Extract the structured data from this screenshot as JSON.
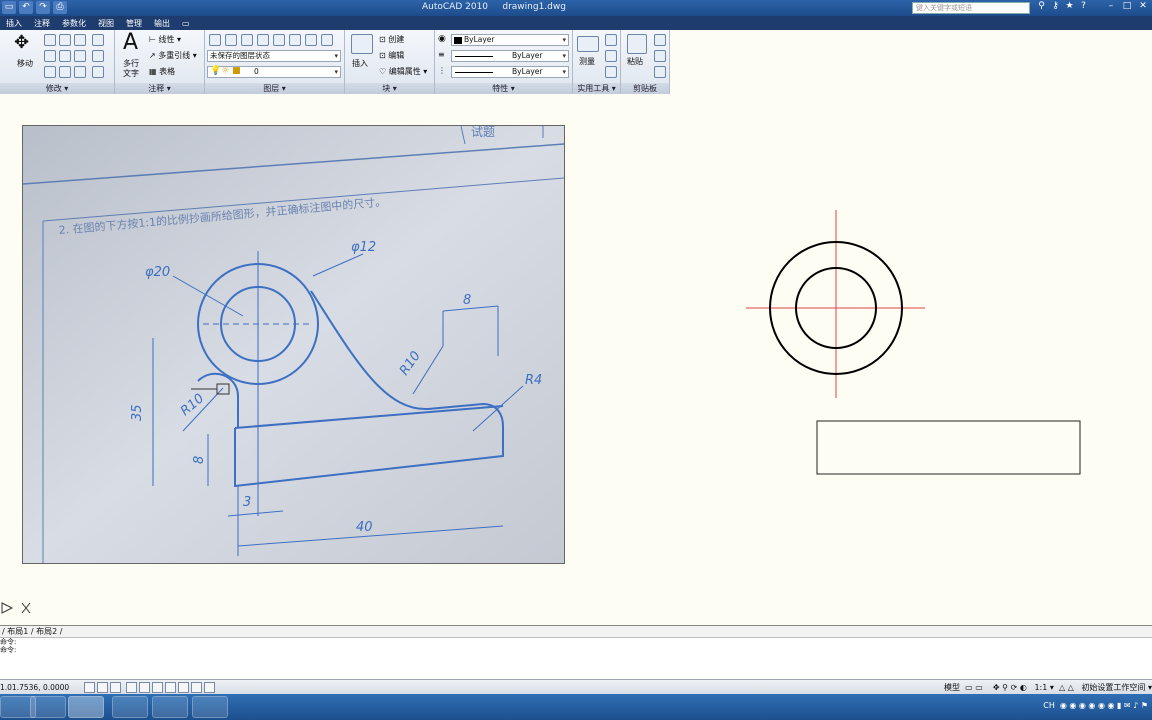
{
  "titlebar": {
    "title": "AutoCAD 2010",
    "file": "drawing1.dwg",
    "search_placeholder": "键入关键字或短语"
  },
  "menu": [
    "插入",
    "注释",
    "参数化",
    "视图",
    "管理",
    "输出"
  ],
  "ribbon": {
    "modify": {
      "label": "修改 ▾",
      "move": "移动"
    },
    "annotation": {
      "label": "注释 ▾",
      "text": "多行\n文字",
      "text_line1": "多行",
      "text_line2": "文字",
      "linear": "线性 ▾",
      "leader": "多重引线 ▾",
      "table": "表格"
    },
    "layers": {
      "label": "图层 ▾",
      "state": "未保存的图层状态",
      "current": "0"
    },
    "block": {
      "label": "块 ▾",
      "insert": "插入",
      "create": "创建",
      "edit": "编辑",
      "edit_attr": "编辑属性 ▾"
    },
    "properties": {
      "label": "特性 ▾",
      "color": "ByLayer",
      "linetype": "ByLayer",
      "lineweight": "ByLayer"
    },
    "utilities": {
      "label": "实用工具 ▾",
      "measure": "测量"
    },
    "clipboard": {
      "label": "剪贴板",
      "paste": "粘贴"
    }
  },
  "photo": {
    "question": "2. 在图的下方按1:1的比例抄画所给图形，并正确标注图中的尺寸。",
    "tab_text": "试题",
    "dims": {
      "d20": "φ20",
      "d12": "φ12",
      "r10a": "R10",
      "r10b": "R10",
      "r4": "R4",
      "w8": "8",
      "h35": "35",
      "h8": "8",
      "w3": "3",
      "w40": "40"
    }
  },
  "tabs": {
    "text": "/ 布局1 / 布局2 /"
  },
  "command": {
    "line1": "命令:",
    "line2": "命令:"
  },
  "status": {
    "coords": "1.01.7536, 0.0000",
    "model": "模型",
    "scale": "1:1 ▾",
    "workspace": "初始设置工作空间 ▾"
  },
  "taskbar": {
    "time": "CH"
  }
}
